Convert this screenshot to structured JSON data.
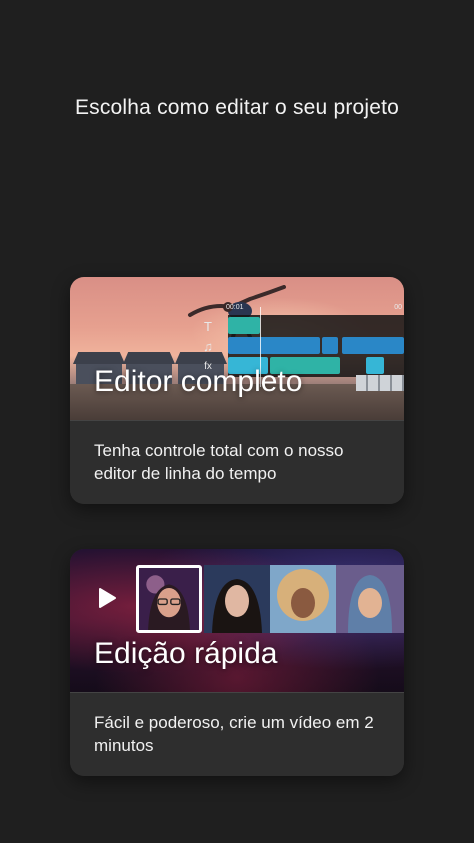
{
  "screen": {
    "title": "Escolha como editar o seu projeto"
  },
  "cards": [
    {
      "id": "full-editor",
      "title": "Editor completo",
      "description": "Tenha controle total com o nosso editor de linha do tempo",
      "timeline": {
        "timecode_left": "00:01",
        "timecode_right": "00",
        "tool_icons": [
          "text-icon",
          "music-note-icon",
          "fx-icon"
        ],
        "tool_glyphs": [
          "T",
          "♫",
          "fx"
        ]
      }
    },
    {
      "id": "quick-edit",
      "title": "Edição rápida",
      "description": "Fácil e poderoso, crie um vídeo em 2 minutos",
      "icon": "play-icon"
    }
  ],
  "colors": {
    "background": "#1f1f1f",
    "card": "#2e2e2e",
    "clip_teal": "#2fb3a6",
    "clip_blue": "#2a87c7",
    "clip_cyan": "#36b6d6"
  }
}
